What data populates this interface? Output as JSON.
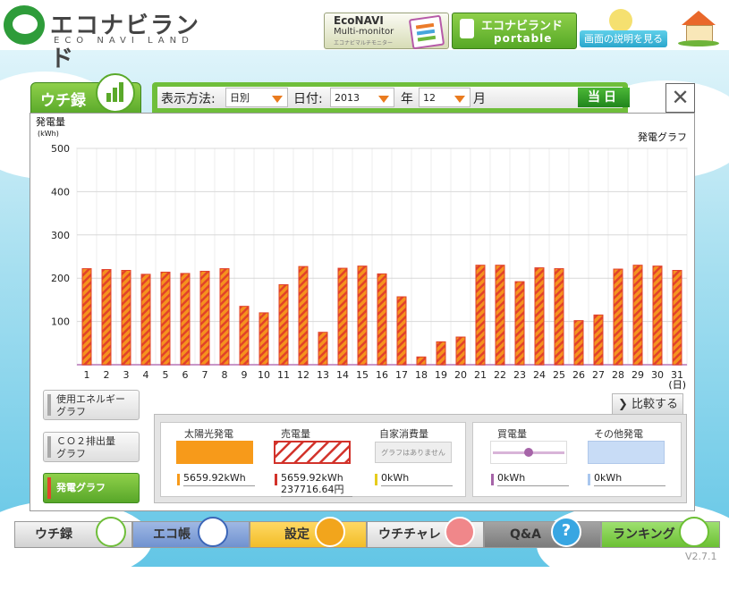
{
  "header": {
    "logo_title": "エコナビランド",
    "logo_subtitle": "ECO NAVI LAND",
    "econavi": {
      "line1": "EcoNAVI",
      "line2": "Multi-monitor",
      "line3": "エコナビマルチモニター"
    },
    "portable": {
      "line1": "エコナビランド",
      "line2": "portable"
    },
    "help_label": "画面の説明を見る"
  },
  "tab": {
    "label": "ウチ録"
  },
  "controls": {
    "display_method_label": "表示方法:",
    "display_method_value": "日別",
    "date_label": "日付:",
    "year_value": "2013",
    "year_unit": "年",
    "month_value": "12",
    "month_unit": "月",
    "today_label": "当日"
  },
  "close_label": "✕",
  "side_buttons": [
    {
      "line1": "使用エネルギー",
      "line2": "グラフ"
    },
    {
      "line1": "ＣＯ２排出量",
      "line2": "グラフ"
    },
    {
      "line1": "発電グラフ",
      "line2": ""
    }
  ],
  "compare_label": "比較する",
  "stats": {
    "solar": {
      "label": "太陽光発電",
      "value": "5659.92kWh"
    },
    "sold": {
      "label": "売電量",
      "value": "5659.92kWh",
      "value2": "237716.64円"
    },
    "self_consumption": {
      "label": "自家消費量",
      "placeholder": "グラフはありません",
      "value": "0kWh"
    },
    "purchased": {
      "label": "買電量",
      "value": "0kWh"
    },
    "other": {
      "label": "その他発電",
      "value": "0kWh"
    }
  },
  "nav": [
    {
      "label": "ウチ録",
      "icon": "bar-chart-icon"
    },
    {
      "label": "エコ帳",
      "icon": "notebook-icon"
    },
    {
      "label": "設定",
      "icon": "wrench-icon"
    },
    {
      "label": "ウチチャレ",
      "icon": "flag-icon"
    },
    {
      "label": "Q&A",
      "icon": "question-icon"
    },
    {
      "label": "ランキング",
      "icon": "crown-icon"
    }
  ],
  "version": "V2.7.1",
  "colors": {
    "brand_green": "#5aa92a",
    "bar_fill": "#f08a1c",
    "bar_stripe": "#e0402b",
    "sky_blue": "#63c6e6"
  },
  "chart_data": {
    "type": "bar",
    "title": "発電グラフ",
    "ylabel": "発電量",
    "yunit": "(kWh)",
    "xunit": "(日)",
    "ylim": [
      0,
      500
    ],
    "yticks": [
      100,
      200,
      300,
      400,
      500
    ],
    "categories": [
      "1",
      "2",
      "3",
      "4",
      "5",
      "6",
      "7",
      "8",
      "9",
      "10",
      "11",
      "12",
      "13",
      "14",
      "15",
      "16",
      "17",
      "18",
      "19",
      "20",
      "21",
      "22",
      "23",
      "24",
      "25",
      "26",
      "27",
      "28",
      "29",
      "30",
      "31"
    ],
    "values": [
      222,
      220,
      218,
      209,
      214,
      211,
      216,
      222,
      135,
      120,
      185,
      227,
      75,
      223,
      228,
      210,
      157,
      18,
      53,
      64,
      230,
      230,
      192,
      224,
      222,
      102,
      115,
      221,
      230,
      228,
      218
    ],
    "grid": true
  }
}
